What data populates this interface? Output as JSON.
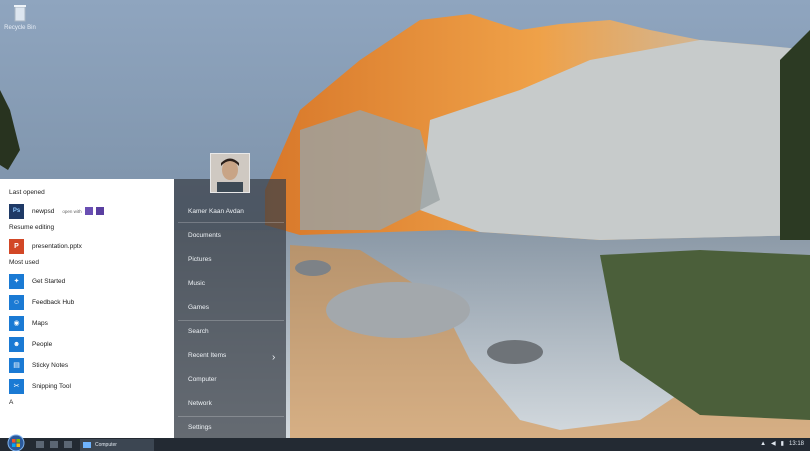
{
  "desktop": {
    "recycle_bin_label": "Recycle Bin",
    "recycle_bin_icon": "recycle-bin-icon"
  },
  "start_menu": {
    "last_opened": {
      "heading": "Last opened",
      "file": "newpsd",
      "open_with_label": "open with",
      "icon": "photoshop-icon"
    },
    "resume_editing": {
      "heading": "Resume editing",
      "file": "presentation.pptx",
      "icon": "powerpoint-icon"
    },
    "most_used": {
      "heading": "Most used",
      "items": [
        {
          "label": "Get Started",
          "icon": "lightbulb-icon"
        },
        {
          "label": "Feedback Hub",
          "icon": "feedback-icon"
        },
        {
          "label": "Maps",
          "icon": "maps-icon"
        },
        {
          "label": "People",
          "icon": "people-icon"
        },
        {
          "label": "Sticky Notes",
          "icon": "sticky-notes-icon"
        },
        {
          "label": "Snipping Tool",
          "icon": "scissors-icon"
        }
      ]
    },
    "alpha_header": "A",
    "right_pane": {
      "user_name": "Kamer Kaan Avdan",
      "items": [
        "Documents",
        "Pictures",
        "Music",
        "Games",
        "Search",
        "Recent Items",
        "Computer",
        "Network",
        "Settings"
      ]
    }
  },
  "taskbar": {
    "active_app_label": "Computer",
    "clock": "13:18",
    "accent": "#1a7ad4"
  }
}
